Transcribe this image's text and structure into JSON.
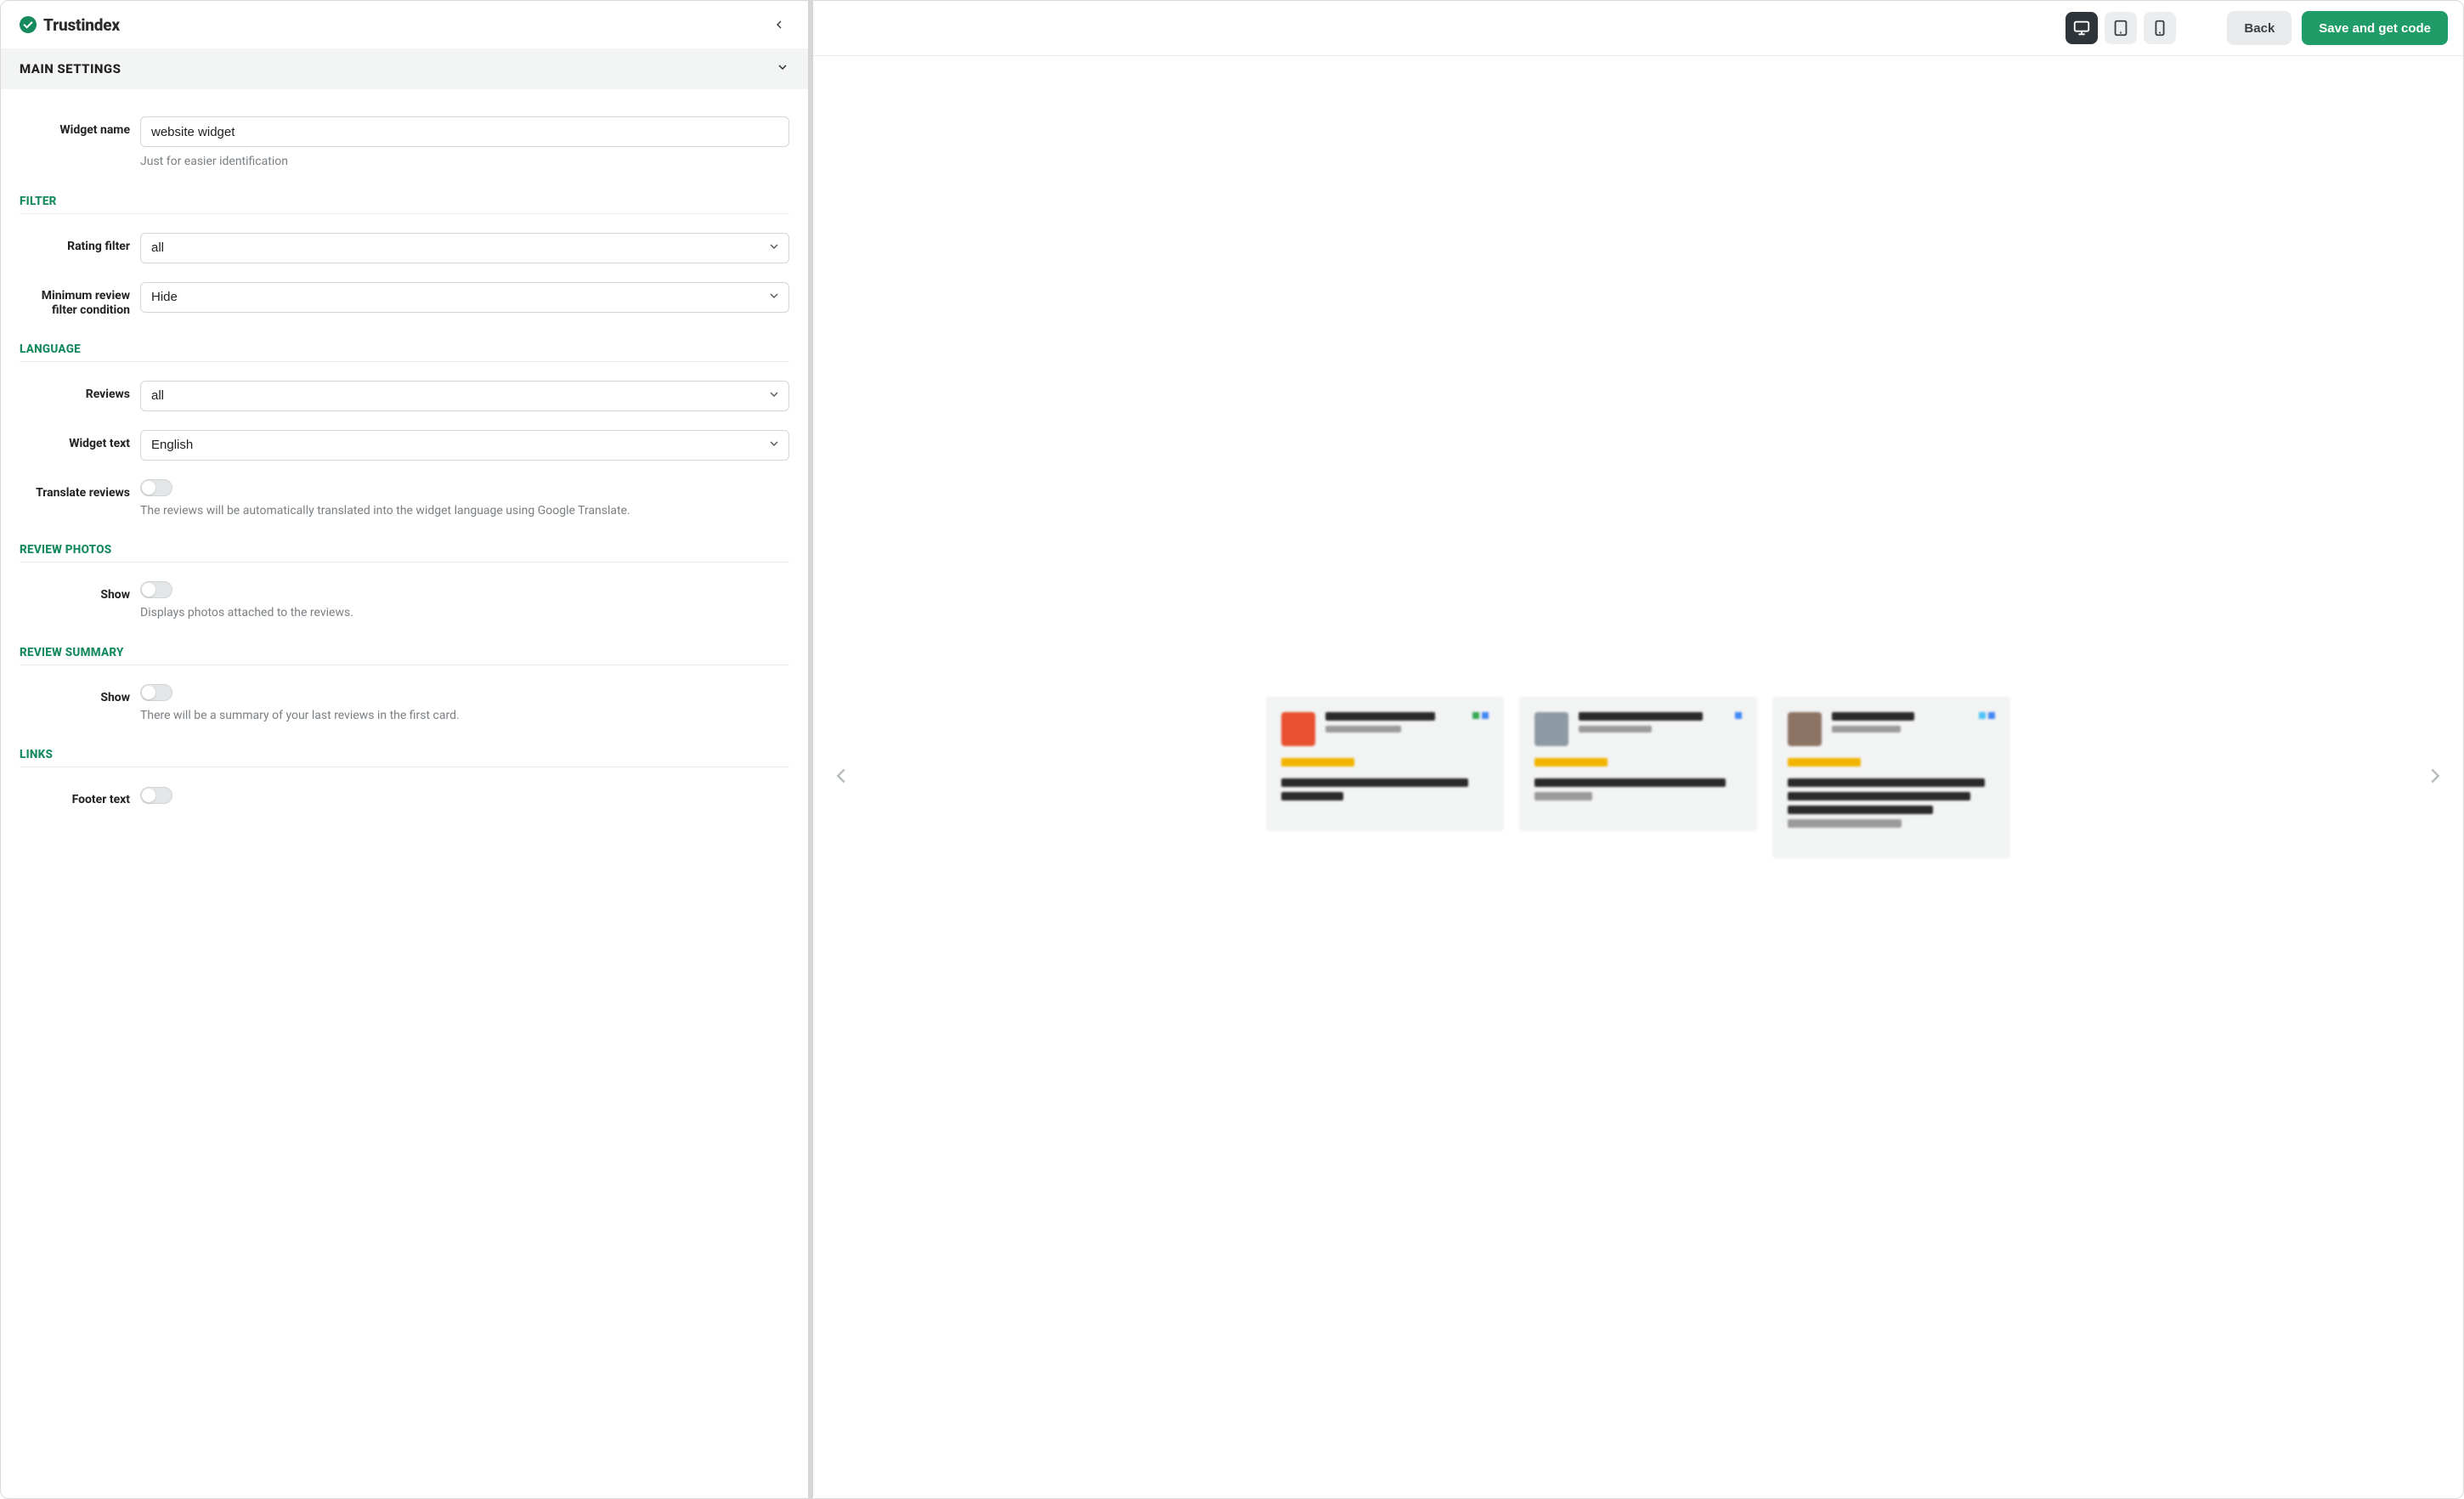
{
  "brand": {
    "name": "Trustindex"
  },
  "section": {
    "title": "MAIN SETTINGS"
  },
  "form": {
    "widget_name": {
      "label": "Widget name",
      "value": "website widget",
      "hint": "Just for easier identification"
    },
    "filter": {
      "heading": "FILTER",
      "rating_filter": {
        "label": "Rating filter",
        "value": "all"
      },
      "min_review": {
        "label": "Minimum review filter condition",
        "value": "Hide"
      }
    },
    "language": {
      "heading": "LANGUAGE",
      "reviews": {
        "label": "Reviews",
        "value": "all"
      },
      "widget_text": {
        "label": "Widget text",
        "value": "English"
      },
      "translate": {
        "label": "Translate reviews",
        "hint": "The reviews will be automatically translated into the widget language using Google Translate."
      }
    },
    "photos": {
      "heading": "REVIEW PHOTOS",
      "show": {
        "label": "Show",
        "hint": "Displays photos attached to the reviews."
      }
    },
    "summary": {
      "heading": "REVIEW SUMMARY",
      "show": {
        "label": "Show",
        "hint": "There will be a summary of your last reviews in the first card."
      }
    },
    "links": {
      "heading": "LINKS",
      "footer_text": {
        "label": "Footer text"
      }
    }
  },
  "topbar": {
    "back": "Back",
    "save": "Save and get code"
  }
}
